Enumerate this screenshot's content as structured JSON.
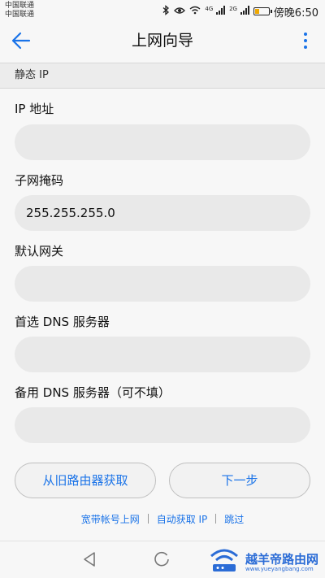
{
  "status_bar": {
    "carrier_1": "中国联通",
    "carrier_2": "中国联通",
    "net_1": "4G",
    "net_2": "2G",
    "clock": "傍晚6:50",
    "battery_level": 0.3
  },
  "header": {
    "title": "上网向导"
  },
  "section": {
    "title": "静态 IP"
  },
  "form": {
    "ip_label": "IP 地址",
    "ip_value": "",
    "subnet_label": "子网掩码",
    "subnet_value": "255.255.255.0",
    "gateway_label": "默认网关",
    "gateway_value": "",
    "dns1_label": "首选 DNS 服务器",
    "dns1_value": "",
    "dns2_label": "备用 DNS 服务器（可不填）",
    "dns2_value": ""
  },
  "buttons": {
    "fetch_from_old_router": "从旧路由器获取",
    "next_step": "下一步"
  },
  "links": {
    "broadband_login": "宽带帐号上网",
    "auto_ip": "自动获取 IP",
    "skip": "跳过"
  },
  "watermark": {
    "text": "越羊帝路由网",
    "url": "www.yueyangbang.com"
  },
  "colors": {
    "accent": "#1a73e8",
    "battery": "#f0a800"
  }
}
